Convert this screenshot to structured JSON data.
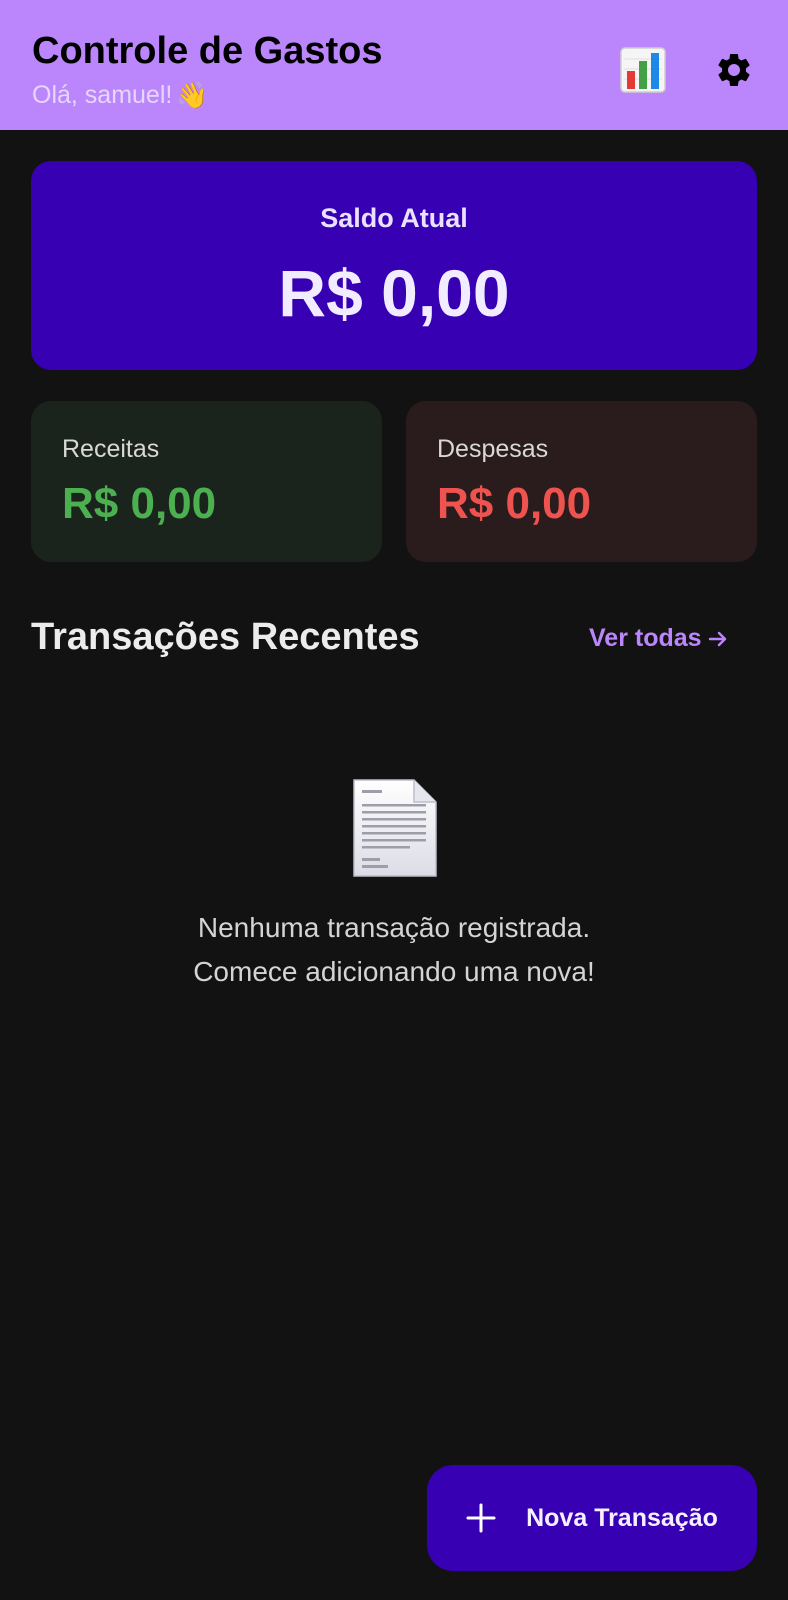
{
  "header": {
    "title": "Controle de Gastos",
    "greeting": "Olá, samuel!",
    "greeting_emoji": "👋",
    "stats_icon": "bar-chart-icon",
    "settings_icon": "gear-icon",
    "background_color": "#bb86fc"
  },
  "balance": {
    "label": "Saldo Atual",
    "value": "R$ 0,00",
    "card_color": "#3700b3"
  },
  "summary": {
    "income": {
      "label": "Receitas",
      "value": "R$ 0,00",
      "color": "#4caf50"
    },
    "expenses": {
      "label": "Despesas",
      "value": "R$ 0,00",
      "color": "#ef5350"
    }
  },
  "recent": {
    "title": "Transações Recentes",
    "view_all_label": "Ver todas",
    "view_all_icon": "arrow-right-icon",
    "empty_icon": "document-icon",
    "empty_line_1": "Nenhuma transação registrada.",
    "empty_line_2": "Comece adicionando uma nova!"
  },
  "fab": {
    "label": "Nova Transação",
    "icon": "plus-icon"
  }
}
